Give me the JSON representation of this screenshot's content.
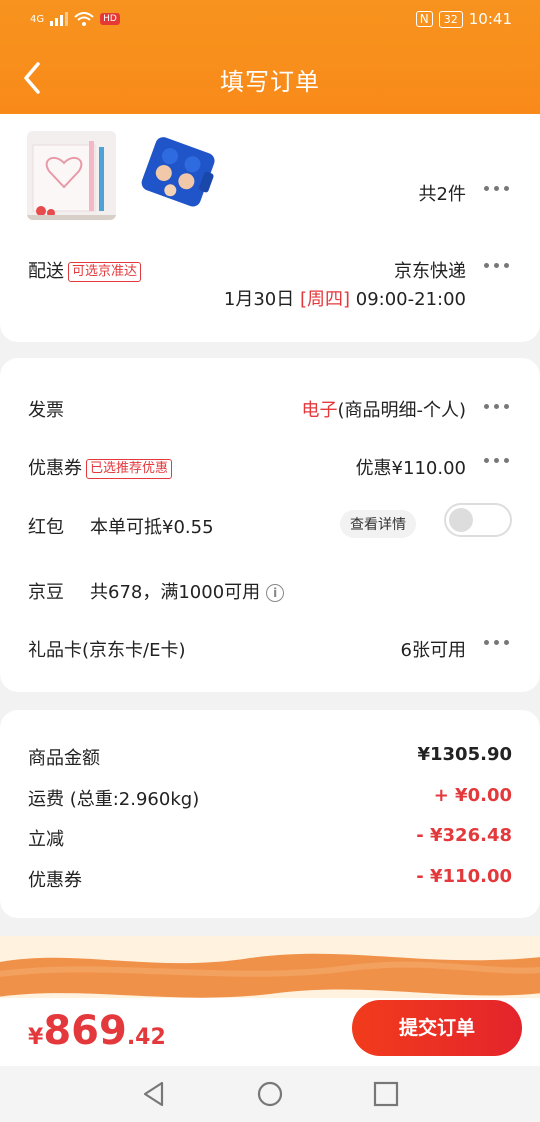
{
  "status_bar": {
    "signal_text": "4G",
    "badge": "HD",
    "nfc": "N",
    "battery": "32",
    "time": "10:41"
  },
  "header": {
    "title": "填写订单",
    "back_icon": "chevron-left-icon"
  },
  "products": {
    "count_text": "共2件"
  },
  "delivery": {
    "label": "配送",
    "tag": "可选京准达",
    "carrier": "京东快递",
    "date": "1月30日",
    "weekday": "[周四]",
    "time_range": "09:00-21:00"
  },
  "invoice": {
    "label": "发票",
    "type_red": "电子",
    "type_rest": "(商品明细-个人)"
  },
  "coupon": {
    "label": "优惠券",
    "tag": "已选推荐优惠",
    "value": "优惠¥110.00"
  },
  "red_packet": {
    "label": "红包",
    "desc": "本单可抵¥0.55",
    "detail_btn": "查看详情"
  },
  "jingdou": {
    "label": "京豆",
    "desc": "共678，满1000可用",
    "info_icon": "i"
  },
  "gift_card": {
    "label": "礼品卡(京东卡/E卡)",
    "value": "6张可用"
  },
  "summary": {
    "rows": [
      {
        "label": "商品金额",
        "amount": "¥1305.90"
      },
      {
        "label": "运费 (总重:2.960kg)",
        "amount": "+ ¥0.00"
      },
      {
        "label": "立减",
        "amount": "- ¥326.48"
      },
      {
        "label": "优惠券",
        "amount": "- ¥110.00"
      }
    ]
  },
  "footer": {
    "currency": "¥",
    "total_int": "869",
    "total_dec": ".42",
    "submit_label": "提交订单"
  },
  "colors": {
    "accent": "#f7931e",
    "price_red": "#e4393c"
  }
}
